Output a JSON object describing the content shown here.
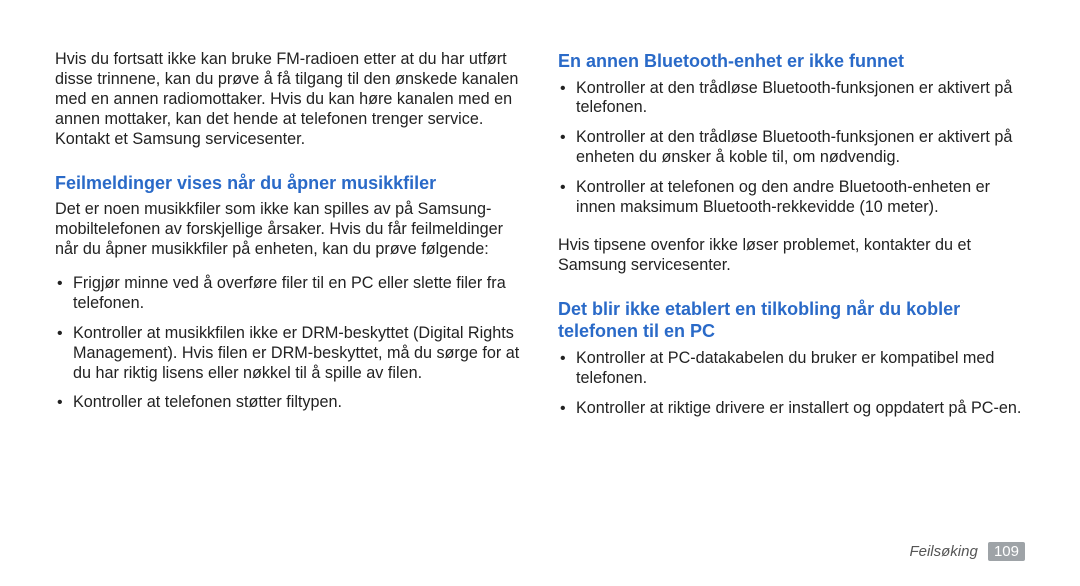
{
  "left": {
    "intro": "Hvis du fortsatt ikke kan bruke FM-radioen etter at du har utført disse trinnene, kan du prøve å få tilgang til den ønskede kanalen med en annen radiomottaker. Hvis du kan høre kanalen med en annen mottaker, kan det hende at telefonen trenger service. Kontakt et Samsung servicesenter.",
    "heading1": "Feilmeldinger vises når du åpner musikkfiler",
    "para1": "Det er noen musikkfiler som ikke kan spilles av på Samsung-mobiltelefonen av forskjellige årsaker. Hvis du får feilmeldinger når du åpner musikkfiler på enheten, kan du prøve følgende:",
    "bullets": [
      "Frigjør minne ved å overføre filer til en PC eller slette filer fra telefonen.",
      "Kontroller at musikkfilen ikke er DRM-beskyttet (Digital Rights Management). Hvis filen er DRM-beskyttet, må du sørge for at du har riktig lisens eller nøkkel til å spille av filen.",
      "Kontroller at telefonen støtter filtypen."
    ]
  },
  "right": {
    "heading1": "En annen Bluetooth-enhet er ikke funnet",
    "bullets1": [
      "Kontroller at den trådløse Bluetooth-funksjonen er aktivert på telefonen.",
      "Kontroller at den trådløse Bluetooth-funksjonen er aktivert på enheten du ønsker å koble til, om nødvendig.",
      "Kontroller at telefonen og den andre Bluetooth-enheten er innen maksimum Bluetooth-rekkevidde (10 meter)."
    ],
    "para1": "Hvis tipsene ovenfor ikke løser problemet, kontakter du et Samsung servicesenter.",
    "heading2": "Det blir ikke etablert en tilkobling når du kobler telefonen til en PC",
    "bullets2": [
      "Kontroller at PC-datakabelen du bruker er kompatibel med telefonen.",
      "Kontroller at riktige drivere er installert og oppdatert på PC-en."
    ]
  },
  "footer": {
    "section": "Feilsøking",
    "page": "109"
  }
}
